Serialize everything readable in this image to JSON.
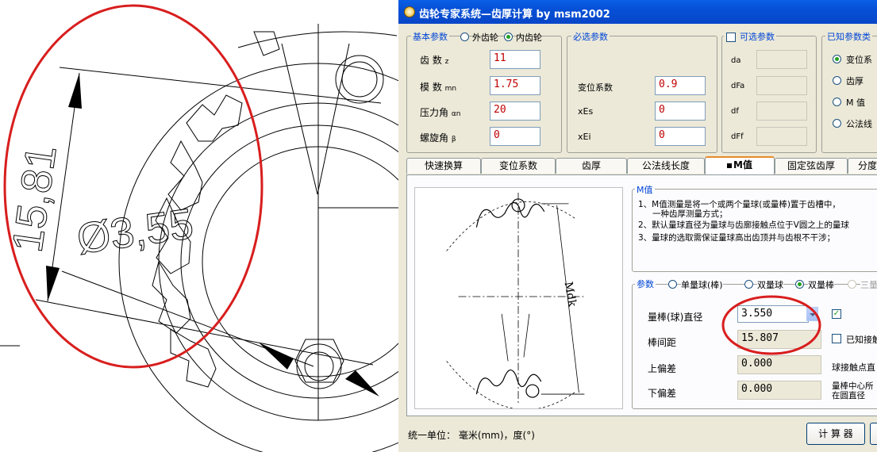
{
  "window": {
    "title": "齿轮专家系统—齿厚计算 by msm2002"
  },
  "basic_params": {
    "legend": "基本参数",
    "radio_external": "外齿轮",
    "radio_internal": "内齿轮",
    "selected": "内齿轮",
    "fields": [
      {
        "label": "齿  数",
        "sub": "z",
        "value": "11"
      },
      {
        "label": "模  数",
        "sub": "mn",
        "value": "1.75"
      },
      {
        "label": "压力角",
        "sub": "αn",
        "value": "20"
      },
      {
        "label": "螺旋角",
        "sub": "β",
        "value": "0"
      }
    ]
  },
  "required_params": {
    "legend": "必选参数",
    "fields": [
      {
        "label": "变位系数",
        "value": "0.9"
      },
      {
        "label": "xEs",
        "value": "0"
      },
      {
        "label": "xEi",
        "value": "0"
      }
    ]
  },
  "optional_params": {
    "legend": "可选参数",
    "checked": false,
    "fields": [
      {
        "label": "da",
        "value": ""
      },
      {
        "label": "dFa",
        "value": ""
      },
      {
        "label": "df",
        "value": ""
      },
      {
        "label": "dFf",
        "value": ""
      }
    ]
  },
  "known_params": {
    "legend": "已知参数类",
    "options": [
      "变位系",
      "齿厚",
      "M 值",
      "公法线"
    ],
    "selected": "变位系"
  },
  "tabs": [
    "快速换算",
    "变位系数",
    "齿厚",
    "公法线长度",
    "M值",
    "固定弦齿厚",
    "分度"
  ],
  "active_tab": "M值",
  "m_value": {
    "legend": "M值",
    "notes": [
      "1、M值测量是将一个或两个量球(或量棒)置于齿槽中，",
      "一种齿厚测量方式；",
      "2、默认量球直径为量球与齿廓接触点位于V圆之上的量球",
      "3、量球的选取需保证量球高出齿顶并与齿根不干涉；"
    ],
    "image_label": "Mdk"
  },
  "params": {
    "legend": "参数",
    "radios": [
      "单量球(棒)",
      "双量球",
      "双量棒",
      "三量"
    ],
    "selected": "双量棒",
    "rows": [
      {
        "label": "量棒(球)直径",
        "value": "3.550"
      },
      {
        "label": "棒间距",
        "value": "15.807"
      },
      {
        "label": "上偏差",
        "value": "0.000"
      },
      {
        "label": "下偏差",
        "value": "0.000"
      }
    ],
    "right_check_checked": true,
    "known_contact_label": "已知接触",
    "ball_contact_label": "球接触点直",
    "center_circle_label_1": "量棒中心所",
    "center_circle_label_2": "在圆直径"
  },
  "status": {
    "unit_text": "统一单位： 毫米(mm)，度(°)"
  },
  "buttons": {
    "calculate": "计 算 器"
  },
  "cad": {
    "dim_length": "15,81",
    "dim_diameter": "Ø3,55"
  },
  "colors": {
    "annotation_red": "#D81E1E",
    "input_text": "#C00000",
    "accent_blue": "#0046D5"
  }
}
